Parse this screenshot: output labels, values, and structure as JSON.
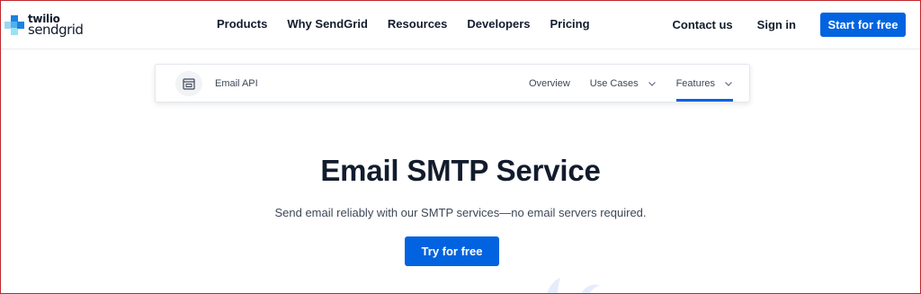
{
  "brand": {
    "line1": "twilio",
    "line2": "sendgrid"
  },
  "topnav": {
    "links": [
      "Products",
      "Why SendGrid",
      "Resources",
      "Developers",
      "Pricing"
    ],
    "contact": "Contact us",
    "signin": "Sign in",
    "cta": "Start for free"
  },
  "subnav": {
    "product": "Email API",
    "product_icon": "browser-window-icon",
    "items": [
      {
        "label": "Overview",
        "has_dropdown": false,
        "active": false
      },
      {
        "label": "Use Cases",
        "has_dropdown": true,
        "active": false
      },
      {
        "label": "Features",
        "has_dropdown": true,
        "active": true
      }
    ]
  },
  "hero": {
    "title": "Email SMTP Service",
    "subtitle": "Send email reliably with our SMTP services—no email servers required.",
    "cta": "Try for free"
  },
  "colors": {
    "primary": "#0263e0",
    "text": "#121c2d",
    "muted": "#3d4757",
    "frame_border": "#c0262d"
  }
}
